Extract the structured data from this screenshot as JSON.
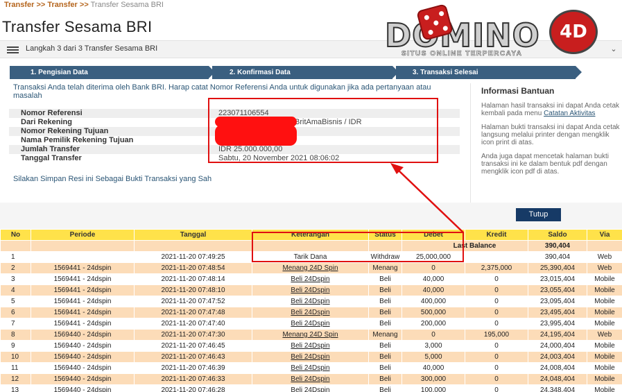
{
  "breadcrumb": {
    "link1": "Transfer",
    "sep1": ">>",
    "link2": "Transfer",
    "sep2": ">>",
    "current": "Transfer Sesama BRI"
  },
  "page_title": "Transfer Sesama BRI",
  "step_bar": {
    "text": "Langkah 3 dari 3 Transfer Sesama BRI",
    "chevron": "⌄"
  },
  "progress": {
    "steps": [
      "1. Pengisian Data",
      "2. Konfirmasi Data",
      "3. Transaksi Selesai"
    ]
  },
  "notice": "Transaksi Anda telah diterima oleh Bank BRI. Harap catat Nomor Referensi Anda untuk digunakan jika ada pertanyaan atau masalah",
  "details": [
    {
      "label": "Nomor Referensi",
      "value": "223071106554",
      "value2": ""
    },
    {
      "label": "Dari Rekening",
      "value": "",
      "value2": "BritAmaBisnis / IDR"
    },
    {
      "label": "Nomor Rekening Tujuan",
      "value": "",
      "value2": ""
    },
    {
      "label": "Nama Pemilik Rekening Tujuan",
      "value": "",
      "value2": ""
    },
    {
      "label": "Jumlah Transfer",
      "value": "IDR 25.000.000,00",
      "value2": ""
    },
    {
      "label": "Tanggal Transfer",
      "value": "Sabtu, 20 November 2021 08:06:02",
      "value2": ""
    }
  ],
  "save_message": "Silakan Simpan Resi ini Sebagai Bukti Transaksi yang Sah",
  "side": {
    "title": "Informasi Bantuan",
    "p1": "Halaman hasil transaksi ini dapat Anda cetak kembali pada menu",
    "p1_link": "Catatan Aktivitas",
    "p2": "Halaman bukti transaksi ini dapat Anda cetak langsung melalui printer dengan mengklik icon print di atas.",
    "p3": "Anda juga dapat mencetak halaman bukti transaksi ini ke dalam bentuk pdf dengan mengklik icon pdf di atas."
  },
  "close_button": "Tutup",
  "logo": {
    "word": "DOMINO",
    "badge": "4D",
    "tagline": "SITUS ONLINE TERPERCAYA"
  },
  "colors": {
    "accent_red": "#e01010",
    "header_yellow": "#ffe24a",
    "row_peach": "#fcdcb8",
    "nav_blue": "#3a5f80",
    "button_navy": "#163a66"
  },
  "table": {
    "headers": [
      "No",
      "Periode",
      "Tanggal",
      "Keterangan",
      "Status",
      "Debet",
      "Kredit",
      "Saldo",
      "Via"
    ],
    "last_balance_label": "Last Balance",
    "last_balance_value": "390,404",
    "rows": [
      {
        "no": "1",
        "periode": "",
        "tanggal": "2021-11-20 07:49:25",
        "ket": "Tarik Dana",
        "ket_link": false,
        "status": "Withdraw",
        "debet": "25,000,000",
        "kredit": "",
        "saldo": "390,404",
        "via": "Web"
      },
      {
        "no": "2",
        "periode": "1569441 - 24dspin",
        "tanggal": "2021-11-20 07:48:54",
        "ket": "Menang 24D Spin",
        "ket_link": true,
        "status": "Menang",
        "debet": "0",
        "kredit": "2,375,000",
        "saldo": "25,390,404",
        "via": "Web"
      },
      {
        "no": "3",
        "periode": "1569441 - 24dspin",
        "tanggal": "2021-11-20 07:48:14",
        "ket": "Beli 24Dspin",
        "ket_link": true,
        "status": "Beli",
        "debet": "40,000",
        "kredit": "0",
        "saldo": "23,015,404",
        "via": "Mobile"
      },
      {
        "no": "4",
        "periode": "1569441 - 24dspin",
        "tanggal": "2021-11-20 07:48:10",
        "ket": "Beli 24Dspin",
        "ket_link": true,
        "status": "Beli",
        "debet": "40,000",
        "kredit": "0",
        "saldo": "23,055,404",
        "via": "Mobile"
      },
      {
        "no": "5",
        "periode": "1569441 - 24dspin",
        "tanggal": "2021-11-20 07:47:52",
        "ket": "Beli 24Dspin",
        "ket_link": true,
        "status": "Beli",
        "debet": "400,000",
        "kredit": "0",
        "saldo": "23,095,404",
        "via": "Mobile"
      },
      {
        "no": "6",
        "periode": "1569441 - 24dspin",
        "tanggal": "2021-11-20 07:47:48",
        "ket": "Beli 24Dspin",
        "ket_link": true,
        "status": "Beli",
        "debet": "500,000",
        "kredit": "0",
        "saldo": "23,495,404",
        "via": "Mobile"
      },
      {
        "no": "7",
        "periode": "1569441 - 24dspin",
        "tanggal": "2021-11-20 07:47:40",
        "ket": "Beli 24Dspin",
        "ket_link": true,
        "status": "Beli",
        "debet": "200,000",
        "kredit": "0",
        "saldo": "23,995,404",
        "via": "Mobile"
      },
      {
        "no": "8",
        "periode": "1569440 - 24dspin",
        "tanggal": "2021-11-20 07:47:30",
        "ket": "Menang 24D Spin",
        "ket_link": true,
        "status": "Menang",
        "debet": "0",
        "kredit": "195,000",
        "saldo": "24,195,404",
        "via": "Web"
      },
      {
        "no": "9",
        "periode": "1569440 - 24dspin",
        "tanggal": "2021-11-20 07:46:45",
        "ket": "Beli 24Dspin",
        "ket_link": true,
        "status": "Beli",
        "debet": "3,000",
        "kredit": "0",
        "saldo": "24,000,404",
        "via": "Mobile"
      },
      {
        "no": "10",
        "periode": "1569440 - 24dspin",
        "tanggal": "2021-11-20 07:46:43",
        "ket": "Beli 24Dspin",
        "ket_link": true,
        "status": "Beli",
        "debet": "5,000",
        "kredit": "0",
        "saldo": "24,003,404",
        "via": "Mobile"
      },
      {
        "no": "11",
        "periode": "1569440 - 24dspin",
        "tanggal": "2021-11-20 07:46:39",
        "ket": "Beli 24Dspin",
        "ket_link": true,
        "status": "Beli",
        "debet": "40,000",
        "kredit": "0",
        "saldo": "24,008,404",
        "via": "Mobile"
      },
      {
        "no": "12",
        "periode": "1569440 - 24dspin",
        "tanggal": "2021-11-20 07:46:33",
        "ket": "Beli 24Dspin",
        "ket_link": true,
        "status": "Beli",
        "debet": "300,000",
        "kredit": "0",
        "saldo": "24,048,404",
        "via": "Mobile"
      },
      {
        "no": "13",
        "periode": "1569440 - 24dspin",
        "tanggal": "2021-11-20 07:46:28",
        "ket": "Beli 24Dspin",
        "ket_link": true,
        "status": "Beli",
        "debet": "100,000",
        "kredit": "0",
        "saldo": "24,348,404",
        "via": "Mobile"
      }
    ]
  }
}
